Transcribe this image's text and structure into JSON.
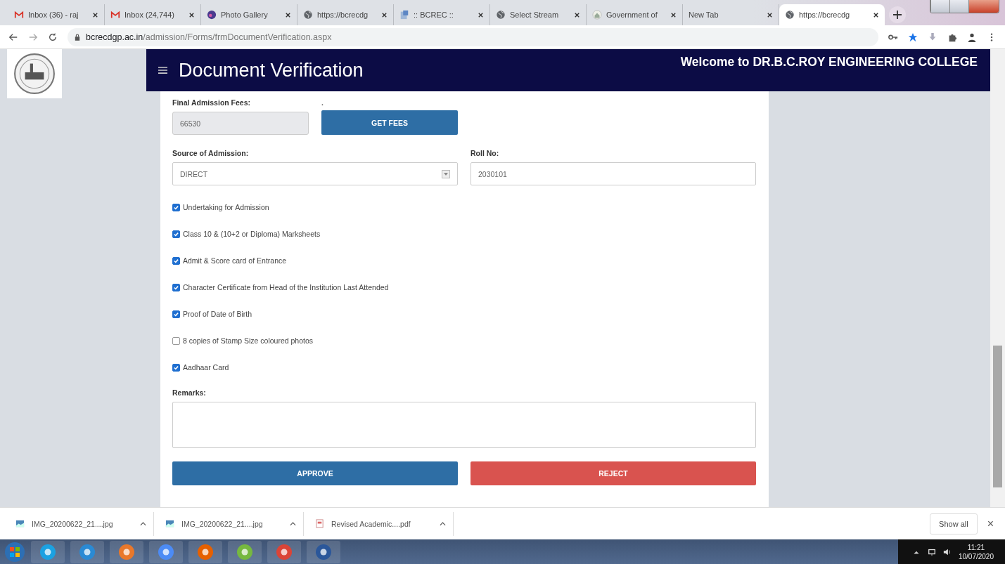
{
  "browser": {
    "tabs": [
      {
        "kind": "mail",
        "title": "Inbox (36) - raj",
        "selected": false
      },
      {
        "kind": "mail",
        "title": "Inbox (24,744)",
        "selected": false
      },
      {
        "kind": "photo",
        "title": "Photo Gallery",
        "selected": false
      },
      {
        "kind": "web",
        "title": "https://bcrecdg",
        "selected": false
      },
      {
        "kind": "doc",
        "title": ":: BCREC ::",
        "selected": false
      },
      {
        "kind": "web",
        "title": "Select Stream",
        "selected": false
      },
      {
        "kind": "home",
        "title": "Government of",
        "selected": false
      },
      {
        "kind": "blank",
        "title": "New Tab",
        "selected": false
      },
      {
        "kind": "web",
        "title": "https://bcrecdg",
        "selected": true
      }
    ],
    "url_host": "bcrecdgp.ac.in",
    "url_path": "/admission/Forms/frmDocumentVerification.aspx"
  },
  "header": {
    "title": "Document Verification",
    "welcome": "Welcome to DR.B.C.ROY ENGINEERING COLLEGE"
  },
  "form": {
    "fees_label": "Final Admission Fees:",
    "fees_value": "66530",
    "fees_button_label": ".",
    "fees_button": "GET FEES",
    "source_label": "Source of Admission:",
    "source_value": "DIRECT",
    "roll_label": "Roll No:",
    "roll_value": "2030101",
    "documents": [
      {
        "label": "Undertaking for Admission",
        "checked": true
      },
      {
        "label": "Class 10 & (10+2 or Diploma) Marksheets",
        "checked": true
      },
      {
        "label": "Admit & Score card of Entrance",
        "checked": true
      },
      {
        "label": "Character Certificate from Head of the Institution Last Attended",
        "checked": true
      },
      {
        "label": "Proof of Date of Birth",
        "checked": true
      },
      {
        "label": "8 copies of Stamp Size coloured photos",
        "checked": false
      },
      {
        "label": "Aadhaar Card",
        "checked": true
      }
    ],
    "remarks_label": "Remarks:",
    "buttons": [
      {
        "kind": "approve",
        "label": "APPROVE"
      },
      {
        "kind": "reject",
        "label": "REJECT"
      }
    ]
  },
  "downloads": {
    "items": [
      {
        "kind": "image",
        "name": "IMG_20200622_21....jpg"
      },
      {
        "kind": "image",
        "name": "IMG_20200622_21....jpg"
      },
      {
        "kind": "pdf",
        "name": "Revised Academic....pdf"
      }
    ],
    "show_all": "Show all",
    "close": "×"
  },
  "taskbar": {
    "time": "11:21",
    "date": "10/07/2020"
  }
}
